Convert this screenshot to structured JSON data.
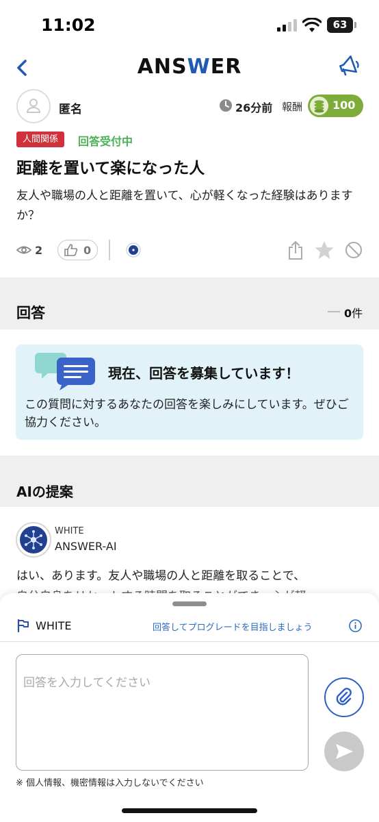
{
  "status_bar": {
    "time": "11:02",
    "battery": "63"
  },
  "header": {
    "logo_prefix": "ANS",
    "logo_accent": "W",
    "logo_suffix": "ER"
  },
  "question": {
    "author": "匿名",
    "time_ago": "26分前",
    "reward_label": "報酬",
    "reward_value": "100",
    "category": "人間関係",
    "status": "回答受付中",
    "title": "距離を置いて楽になった人",
    "body": "友人や職場の人と距離を置いて、心が軽くなった経験はありますか？",
    "views": "2",
    "likes": "0"
  },
  "answers": {
    "title": "回答",
    "count": "0",
    "count_unit": "件"
  },
  "invite": {
    "title": "現在、回答を募集しています！",
    "body": "この質問に対するあなたの回答を楽しみにしています。ぜひご協力ください。"
  },
  "ai": {
    "section_title": "AIの提案",
    "rank": "WHITE",
    "name": "ANSWER-AI",
    "text": "はい、あります。友人や職場の人と距離を取ることで、",
    "text_cont": "自分自身をリセットする時間を取ることができ、心が軽"
  },
  "composer": {
    "rank": "WHITE",
    "upgrade_hint": "回答してプログレードを目指しましょう",
    "placeholder": "回答を入力してください",
    "notice": "※ 個人情報、機密情報は入力しないでください"
  },
  "colors": {
    "brand_blue": "#1f5ab4",
    "category_red": "#d0313b",
    "status_green": "#4bb156",
    "reward_green": "#7eac3a",
    "invite_bg": "#e1f3f9"
  },
  "icons": [
    "back-icon",
    "megaphone-icon",
    "clock-icon",
    "coin-icon",
    "eye-icon",
    "thumbs-up-icon",
    "share-icon",
    "star-icon",
    "block-icon",
    "chat-bubbles-icon",
    "flag-icon",
    "info-icon",
    "paperclip-icon",
    "send-icon"
  ]
}
